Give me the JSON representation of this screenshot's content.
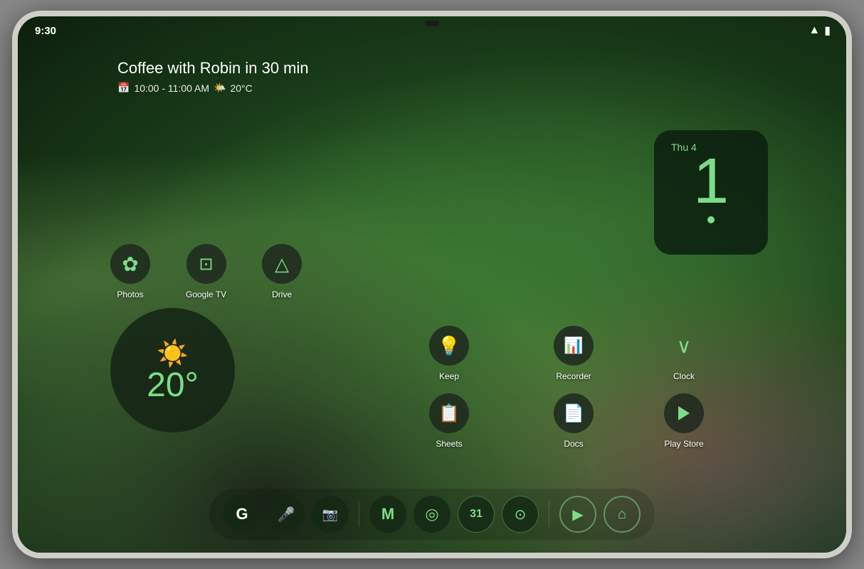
{
  "device": {
    "status_bar": {
      "time": "9:30",
      "wifi_icon": "wifi",
      "battery_icon": "battery"
    }
  },
  "widgets": {
    "calendar": {
      "event_title": "Coffee with Robin in 30 min",
      "event_time": "10:00 - 11:00 AM",
      "weather_temp": "20°C",
      "calendar_icon": "📅",
      "weather_icon": "🌤"
    },
    "clock": {
      "day": "Thu 4",
      "hour": "1",
      "dot": "•"
    },
    "weather": {
      "temp": "20°",
      "sun_icon": "☀️"
    }
  },
  "apps_row": [
    {
      "label": "Photos",
      "icon": "✿"
    },
    {
      "label": "Google TV",
      "icon": "⊡"
    },
    {
      "label": "Drive",
      "icon": "△"
    }
  ],
  "apps_right": [
    {
      "label": "Keep",
      "icon": "💡"
    },
    {
      "label": "Recorder",
      "icon": "📊"
    },
    {
      "label": "Clock",
      "icon": "∨"
    },
    {
      "label": "Sheets",
      "icon": "📋"
    },
    {
      "label": "Docs",
      "icon": "📄"
    },
    {
      "label": "Play Store",
      "icon": "▶"
    }
  ],
  "dock": [
    {
      "label": "Google",
      "icon": "G",
      "type": "filled"
    },
    {
      "label": "Mic",
      "icon": "🎤",
      "type": "filled"
    },
    {
      "label": "Camera",
      "icon": "📷",
      "type": "filled"
    },
    {
      "label": "Gmail",
      "icon": "M",
      "type": "filled"
    },
    {
      "label": "Chrome",
      "icon": "◎",
      "type": "filled"
    },
    {
      "label": "Calendar",
      "icon": "31",
      "type": "filled"
    },
    {
      "label": "Camera2",
      "icon": "⊙",
      "type": "filled"
    },
    {
      "label": "YouTube",
      "icon": "▶",
      "type": "outlined"
    },
    {
      "label": "Home",
      "icon": "⌂",
      "type": "outlined"
    }
  ]
}
